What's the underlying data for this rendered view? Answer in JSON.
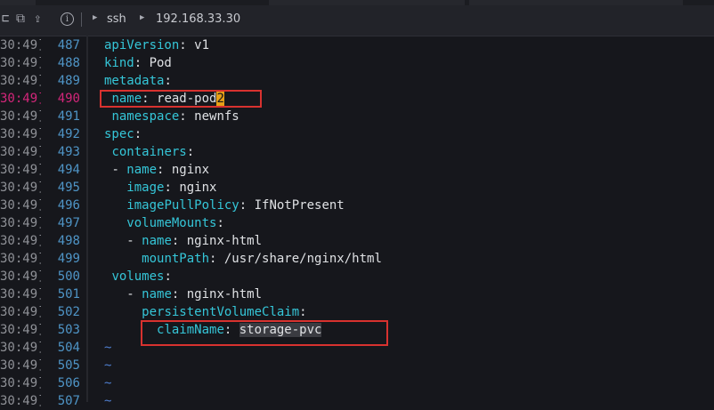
{
  "breadcrumb": {
    "items": [
      "ssh",
      "192.168.33.30"
    ]
  },
  "timestamp": "30:49]",
  "lines": [
    {
      "num": "487",
      "indent": "",
      "key": "apiVersion",
      "sep": ": ",
      "val": "v1"
    },
    {
      "num": "488",
      "indent": "",
      "key": "kind",
      "sep": ": ",
      "val": "Pod"
    },
    {
      "num": "489",
      "indent": "",
      "key": "metadata",
      "sep": ":",
      "val": ""
    },
    {
      "num": "490",
      "indent": " ",
      "key": "name",
      "sep": ": ",
      "val": "read-pod",
      "cursor": "2",
      "highlight": true
    },
    {
      "num": "491",
      "indent": " ",
      "key": "namespace",
      "sep": ": ",
      "val": "newnfs"
    },
    {
      "num": "492",
      "indent": "",
      "key": "spec",
      "sep": ":",
      "val": ""
    },
    {
      "num": "493",
      "indent": " ",
      "key": "containers",
      "sep": ":",
      "val": ""
    },
    {
      "num": "494",
      "indent": " ",
      "dash": "- ",
      "key": "name",
      "sep": ": ",
      "val": "nginx"
    },
    {
      "num": "495",
      "indent": "   ",
      "key": "image",
      "sep": ": ",
      "val": "nginx"
    },
    {
      "num": "496",
      "indent": "   ",
      "key": "imagePullPolicy",
      "sep": ": ",
      "val": "IfNotPresent"
    },
    {
      "num": "497",
      "indent": "   ",
      "key": "volumeMounts",
      "sep": ":",
      "val": ""
    },
    {
      "num": "498",
      "indent": "   ",
      "dash": "- ",
      "key": "name",
      "sep": ": ",
      "val": "nginx-html"
    },
    {
      "num": "499",
      "indent": "     ",
      "key": "mountPath",
      "sep": ": ",
      "val": "/usr/share/nginx/html"
    },
    {
      "num": "500",
      "indent": " ",
      "key": "volumes",
      "sep": ":",
      "val": ""
    },
    {
      "num": "501",
      "indent": "   ",
      "dash": "- ",
      "key": "name",
      "sep": ": ",
      "val": "nginx-html"
    },
    {
      "num": "502",
      "indent": "     ",
      "key": "persistentVolumeClaim",
      "sep": ":",
      "val": ""
    },
    {
      "num": "503",
      "indent": "       ",
      "key": "claimName",
      "sep": ": ",
      "val": "",
      "match": "storage-pvc"
    },
    {
      "num": "504",
      "tilde": "~"
    },
    {
      "num": "505",
      "tilde": "~"
    },
    {
      "num": "506",
      "tilde": "~"
    },
    {
      "num": "507",
      "tilde": "~"
    }
  ]
}
